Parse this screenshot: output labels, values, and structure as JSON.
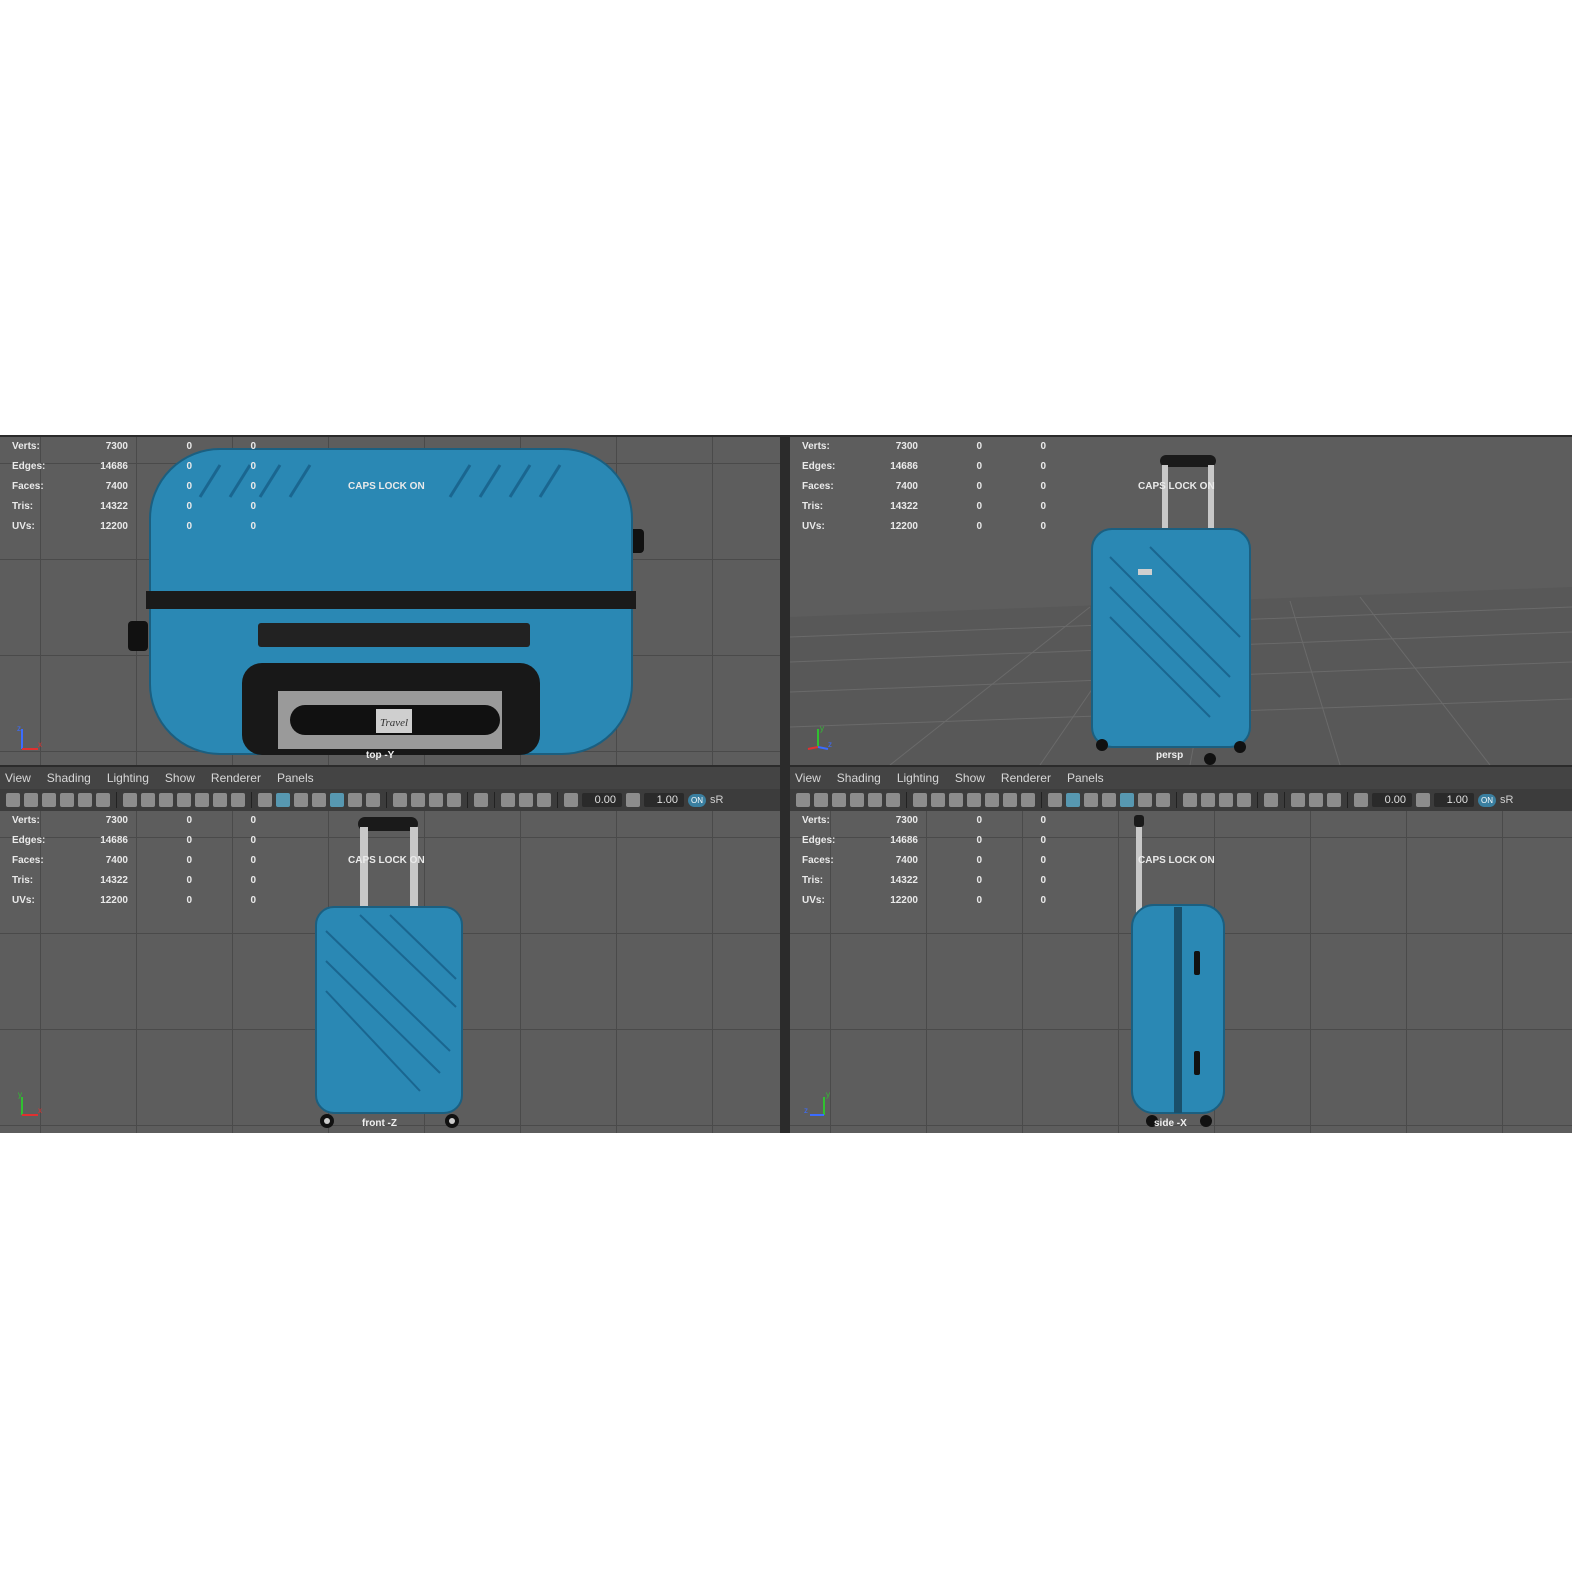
{
  "menu": [
    "View",
    "Shading",
    "Lighting",
    "Show",
    "Renderer",
    "Panels"
  ],
  "hud": {
    "rows": [
      {
        "label": "Verts:",
        "value": "7300",
        "z1": "0",
        "z2": "0"
      },
      {
        "label": "Edges:",
        "value": "14686",
        "z1": "0",
        "z2": "0"
      },
      {
        "label": "Faces:",
        "value": "7400",
        "z1": "0",
        "z2": "0"
      },
      {
        "label": "Tris:",
        "value": "14322",
        "z1": "0",
        "z2": "0"
      },
      {
        "label": "UVs:",
        "value": "12200",
        "z1": "0",
        "z2": "0"
      }
    ]
  },
  "caps_lock": "CAPS LOCK ON",
  "toolbar": {
    "exposure": "0.00",
    "gamma": "1.00",
    "on_badge": "ON",
    "color_space": "sR"
  },
  "viewports": {
    "top": {
      "camera": "top -Y"
    },
    "persp": {
      "camera": "persp"
    },
    "front": {
      "camera": "front -Z"
    },
    "side": {
      "camera": "side -X"
    }
  },
  "axis_labels": {
    "x": "x",
    "y": "y",
    "z": "z"
  },
  "logo_text": "Travel",
  "colors": {
    "suitcase_blue": "#2a88b4",
    "viewport_bg": "#5d5d5d",
    "menubar_bg": "#444444",
    "accent": "#5ca8c6"
  }
}
